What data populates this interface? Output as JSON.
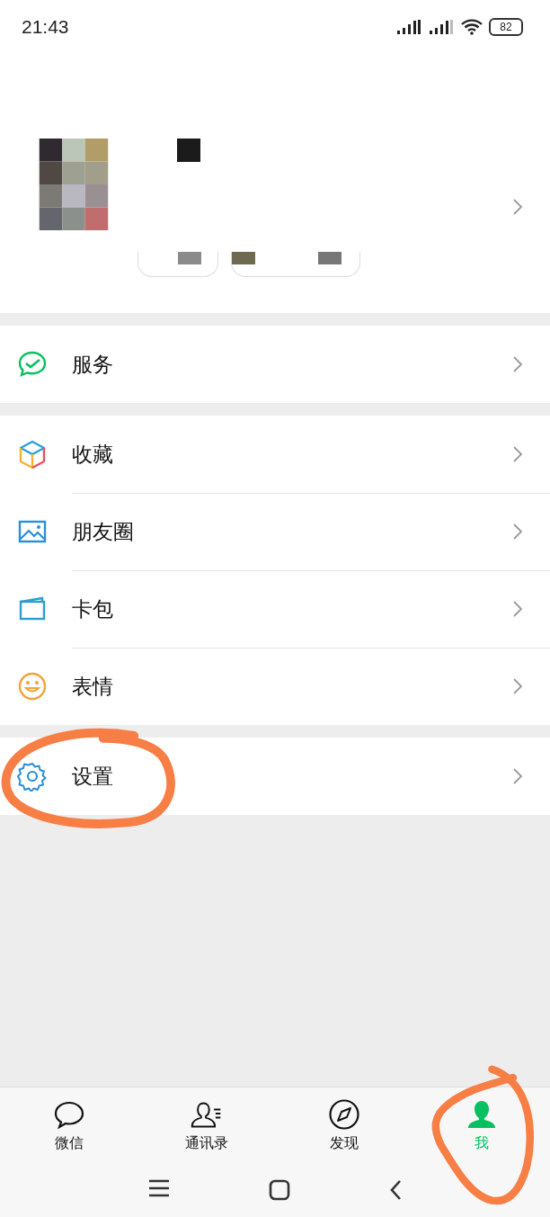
{
  "status_bar": {
    "time": "21:43",
    "battery": "82"
  },
  "menu_groups": [
    [
      {
        "label": "服务",
        "kind": "service"
      }
    ],
    [
      {
        "label": "收藏",
        "kind": "cube"
      },
      {
        "label": "朋友圈",
        "kind": "image"
      },
      {
        "label": "卡包",
        "kind": "wallet"
      },
      {
        "label": "表情",
        "kind": "smile"
      }
    ],
    [
      {
        "label": "设置",
        "kind": "gear"
      }
    ]
  ],
  "tabs": [
    {
      "label": "微信",
      "kind": "chat",
      "selected": false
    },
    {
      "label": "通讯录",
      "kind": "contacts",
      "selected": false
    },
    {
      "label": "发现",
      "kind": "compass",
      "selected": false
    },
    {
      "label": "我",
      "kind": "person",
      "selected": true
    }
  ],
  "annotations": [
    {
      "kind": "circle"
    },
    {
      "kind": "circle"
    }
  ]
}
